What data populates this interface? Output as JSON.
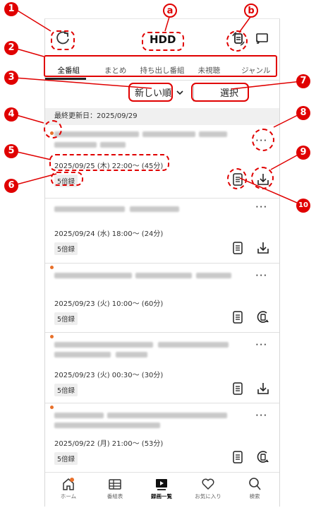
{
  "header": {
    "title": "HDD",
    "refresh_icon": "refresh-icon",
    "storage_icon": "storage-switch-icon",
    "cast_icon": "cast-icon"
  },
  "tabs": [
    {
      "label": "全番組",
      "active": true
    },
    {
      "label": "まとめ"
    },
    {
      "label": "持ち出し番組"
    },
    {
      "label": "未視聴"
    },
    {
      "label": "ジャンル"
    }
  ],
  "sort": {
    "selected": "新しい順",
    "select_button": "選択"
  },
  "updated": "最終更新日：2025/09/29",
  "recordings": [
    {
      "unwatched": true,
      "datetime": "2025/09/25 (木) 22:00〜 (45分)",
      "badge": "5倍録",
      "action": "download"
    },
    {
      "unwatched": false,
      "datetime": "2025/09/24 (水) 18:00〜 (24分)",
      "badge": "5倍録",
      "action": "download"
    },
    {
      "unwatched": true,
      "datetime": "2025/09/23 (火) 10:00〜 (60分)",
      "badge": "5倍録",
      "action": "takeout"
    },
    {
      "unwatched": true,
      "datetime": "2025/09/23 (火) 00:30〜 (30分)",
      "badge": "5倍録",
      "action": "download"
    },
    {
      "unwatched": true,
      "datetime": "2025/09/22 (月) 21:00〜 (53分)",
      "badge": "5倍録",
      "action": "takeout"
    }
  ],
  "bottom_nav": [
    {
      "label": "ホーム",
      "icon": "home-icon",
      "notify": true
    },
    {
      "label": "番組表",
      "icon": "guide-icon"
    },
    {
      "label": "録画一覧",
      "icon": "recordings-icon",
      "active": true
    },
    {
      "label": "お気に入り",
      "icon": "heart-icon"
    },
    {
      "label": "検索",
      "icon": "search-icon"
    }
  ],
  "annotations": {
    "markers": [
      "1",
      "2",
      "3",
      "4",
      "5",
      "6",
      "7",
      "8",
      "9",
      "10"
    ],
    "letters": [
      "a",
      "b"
    ]
  },
  "colors": {
    "annotation": "#e00000",
    "accent": "#e8702a"
  }
}
